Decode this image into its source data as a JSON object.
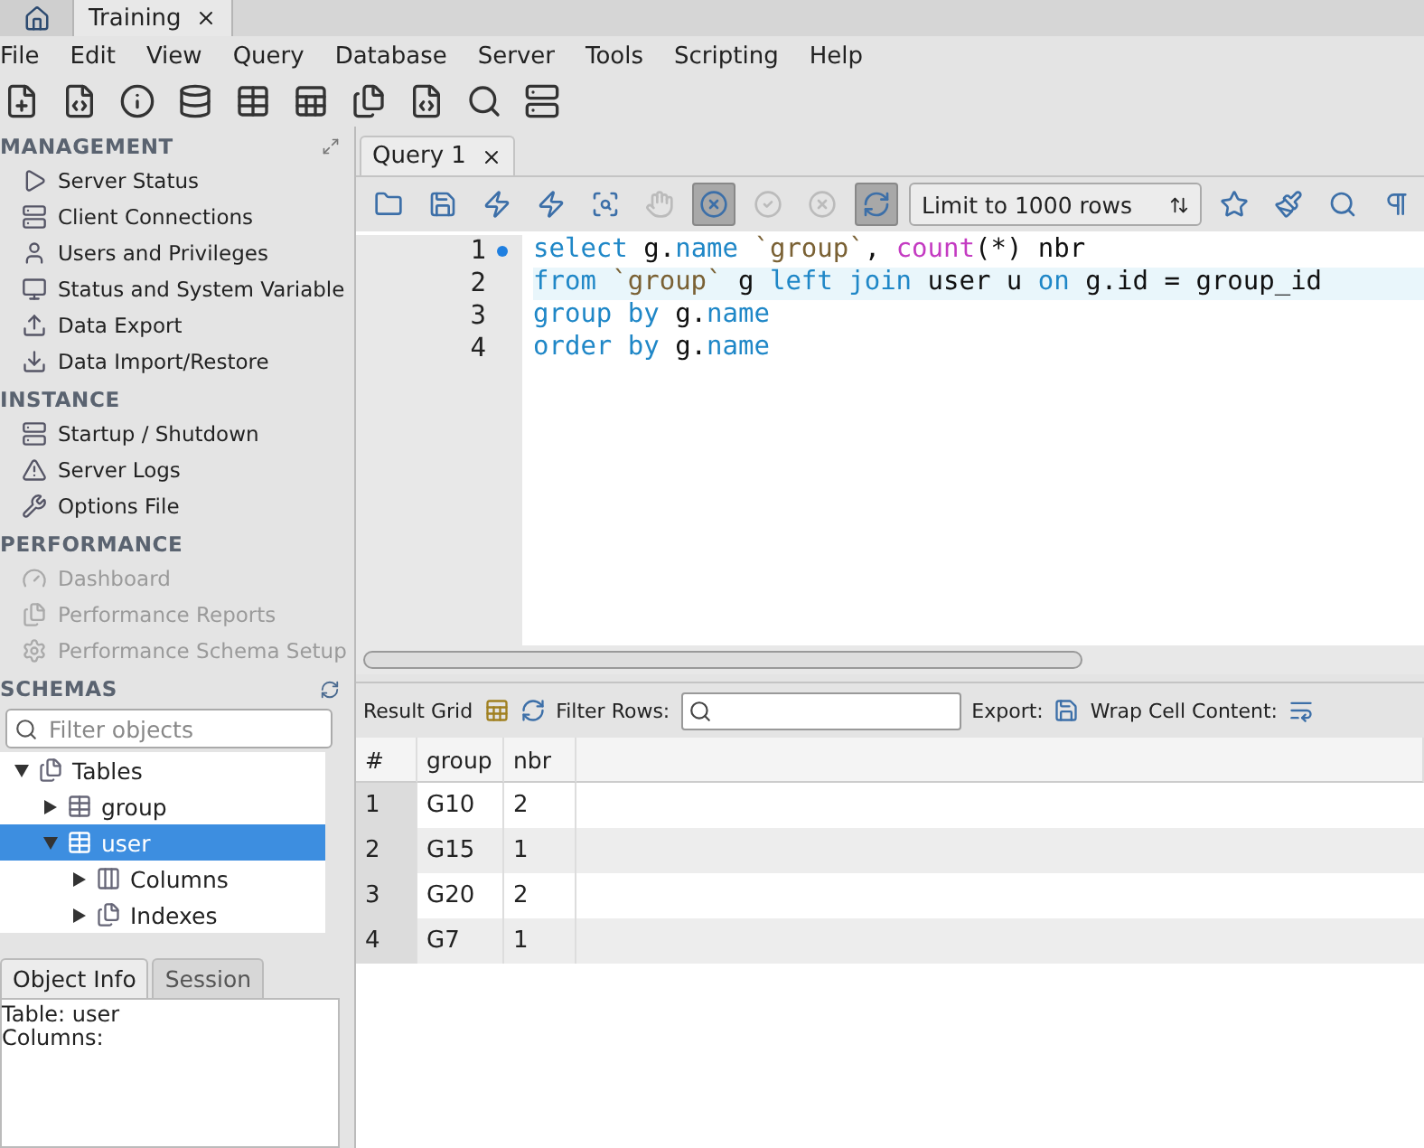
{
  "window": {
    "tabs": [
      {
        "kind": "home",
        "selected": false
      },
      {
        "kind": "connection",
        "label": "Training",
        "selected": true
      }
    ]
  },
  "menu": [
    "File",
    "Edit",
    "View",
    "Query",
    "Database",
    "Server",
    "Tools",
    "Scripting",
    "Help"
  ],
  "sidebar": {
    "sections": [
      {
        "title": "MANAGEMENT",
        "items": [
          {
            "kind": "status",
            "label": "Server Status",
            "disabled": false
          },
          {
            "kind": "connections",
            "label": "Client Connections",
            "disabled": false
          },
          {
            "kind": "users",
            "label": "Users and Privileges",
            "disabled": false
          },
          {
            "kind": "monitor",
            "label": "Status and System Variable",
            "disabled": false
          },
          {
            "kind": "export",
            "label": "Data Export",
            "disabled": false
          },
          {
            "kind": "import",
            "label": "Data Import/Restore",
            "disabled": false
          }
        ]
      },
      {
        "title": "INSTANCE",
        "items": [
          {
            "kind": "power",
            "label": "Startup / Shutdown",
            "disabled": false
          },
          {
            "kind": "logs",
            "label": "Server Logs",
            "disabled": false
          },
          {
            "kind": "options",
            "label": "Options File",
            "disabled": false
          }
        ]
      },
      {
        "title": "PERFORMANCE",
        "items": [
          {
            "kind": "dashboard",
            "label": "Dashboard",
            "disabled": true
          },
          {
            "kind": "reports",
            "label": "Performance Reports",
            "disabled": true
          },
          {
            "kind": "setup",
            "label": "Performance Schema Setup",
            "disabled": true
          }
        ]
      }
    ],
    "schemas": {
      "title": "SCHEMAS",
      "filter_placeholder": "Filter objects",
      "tree": [
        {
          "kind": "folder",
          "label": "Tables",
          "expanded": true,
          "selected": false,
          "children": [
            {
              "kind": "table",
              "label": "group",
              "expanded": false,
              "selected": false
            },
            {
              "kind": "table",
              "label": "user",
              "expanded": true,
              "selected": true,
              "children": [
                {
                  "kind": "columns",
                  "label": "Columns",
                  "expanded": false,
                  "selected": false
                },
                {
                  "kind": "folder",
                  "label": "Indexes",
                  "expanded": false,
                  "selected": false
                }
              ]
            }
          ]
        }
      ]
    },
    "info_tabs": [
      {
        "label": "Object Info",
        "selected": true
      },
      {
        "label": "Session",
        "selected": false
      }
    ],
    "info_lines": [
      "Table: user",
      "Columns:"
    ]
  },
  "query_tab": {
    "label": "Query 1"
  },
  "query_toolbar": {
    "buttons": [
      {
        "kind": "open",
        "pressed": false,
        "disabled": false
      },
      {
        "kind": "save",
        "pressed": false,
        "disabled": false
      },
      {
        "kind": "execute",
        "pressed": false,
        "disabled": false
      },
      {
        "kind": "execute_current",
        "pressed": false,
        "disabled": false
      },
      {
        "kind": "explain",
        "pressed": false,
        "disabled": false
      },
      {
        "kind": "stop",
        "pressed": false,
        "disabled": true
      },
      {
        "kind": "stop_on_error",
        "pressed": true,
        "disabled": false
      },
      {
        "kind": "commit",
        "pressed": false,
        "disabled": true
      },
      {
        "kind": "rollback",
        "pressed": false,
        "disabled": true
      },
      {
        "kind": "autocommit",
        "pressed": true,
        "disabled": false
      }
    ],
    "limit": "Limit to 1000 rows",
    "after": [
      {
        "kind": "snippet",
        "pressed": false,
        "disabled": false
      },
      {
        "kind": "beautify",
        "pressed": false,
        "disabled": false
      },
      {
        "kind": "find",
        "pressed": false,
        "disabled": false
      },
      {
        "kind": "invisible",
        "pressed": false,
        "disabled": false
      }
    ]
  },
  "editor": {
    "lines": [
      {
        "number": "1",
        "marked": true,
        "current": false,
        "tokens": [
          {
            "kind": "kw",
            "text": "select"
          },
          {
            "kind": "plain",
            "text": " g."
          },
          {
            "kind": "kw",
            "text": "name"
          },
          {
            "kind": "str",
            "text": " `group`"
          },
          {
            "kind": "plain",
            "text": ", "
          },
          {
            "kind": "fn",
            "text": "count"
          },
          {
            "kind": "plain",
            "text": "(*) nbr"
          }
        ]
      },
      {
        "number": "2",
        "marked": false,
        "current": true,
        "tokens": [
          {
            "kind": "kw",
            "text": "from"
          },
          {
            "kind": "str",
            "text": " `group`"
          },
          {
            "kind": "plain",
            "text": " g "
          },
          {
            "kind": "kw",
            "text": "left join"
          },
          {
            "kind": "plain",
            "text": " user u "
          },
          {
            "kind": "kw",
            "text": "on"
          },
          {
            "kind": "plain",
            "text": " g.id = group_id"
          }
        ]
      },
      {
        "number": "3",
        "marked": false,
        "current": false,
        "tokens": [
          {
            "kind": "kw",
            "text": "group by"
          },
          {
            "kind": "plain",
            "text": " g."
          },
          {
            "kind": "kw",
            "text": "name"
          }
        ]
      },
      {
        "number": "4",
        "marked": false,
        "current": false,
        "tokens": [
          {
            "kind": "kw",
            "text": "order by"
          },
          {
            "kind": "plain",
            "text": " g."
          },
          {
            "kind": "kw",
            "text": "name"
          }
        ]
      }
    ]
  },
  "results": {
    "toolbar": {
      "result_grid": "Result Grid",
      "filter_label": "Filter Rows:",
      "export_label": "Export:",
      "wrap_label": "Wrap Cell Content:"
    },
    "columns": [
      "#",
      "group",
      "nbr"
    ],
    "rows": [
      [
        "1",
        "G10",
        "2"
      ],
      [
        "2",
        "G15",
        "1"
      ],
      [
        "3",
        "G20",
        "2"
      ],
      [
        "4",
        "G7",
        "1"
      ]
    ]
  }
}
